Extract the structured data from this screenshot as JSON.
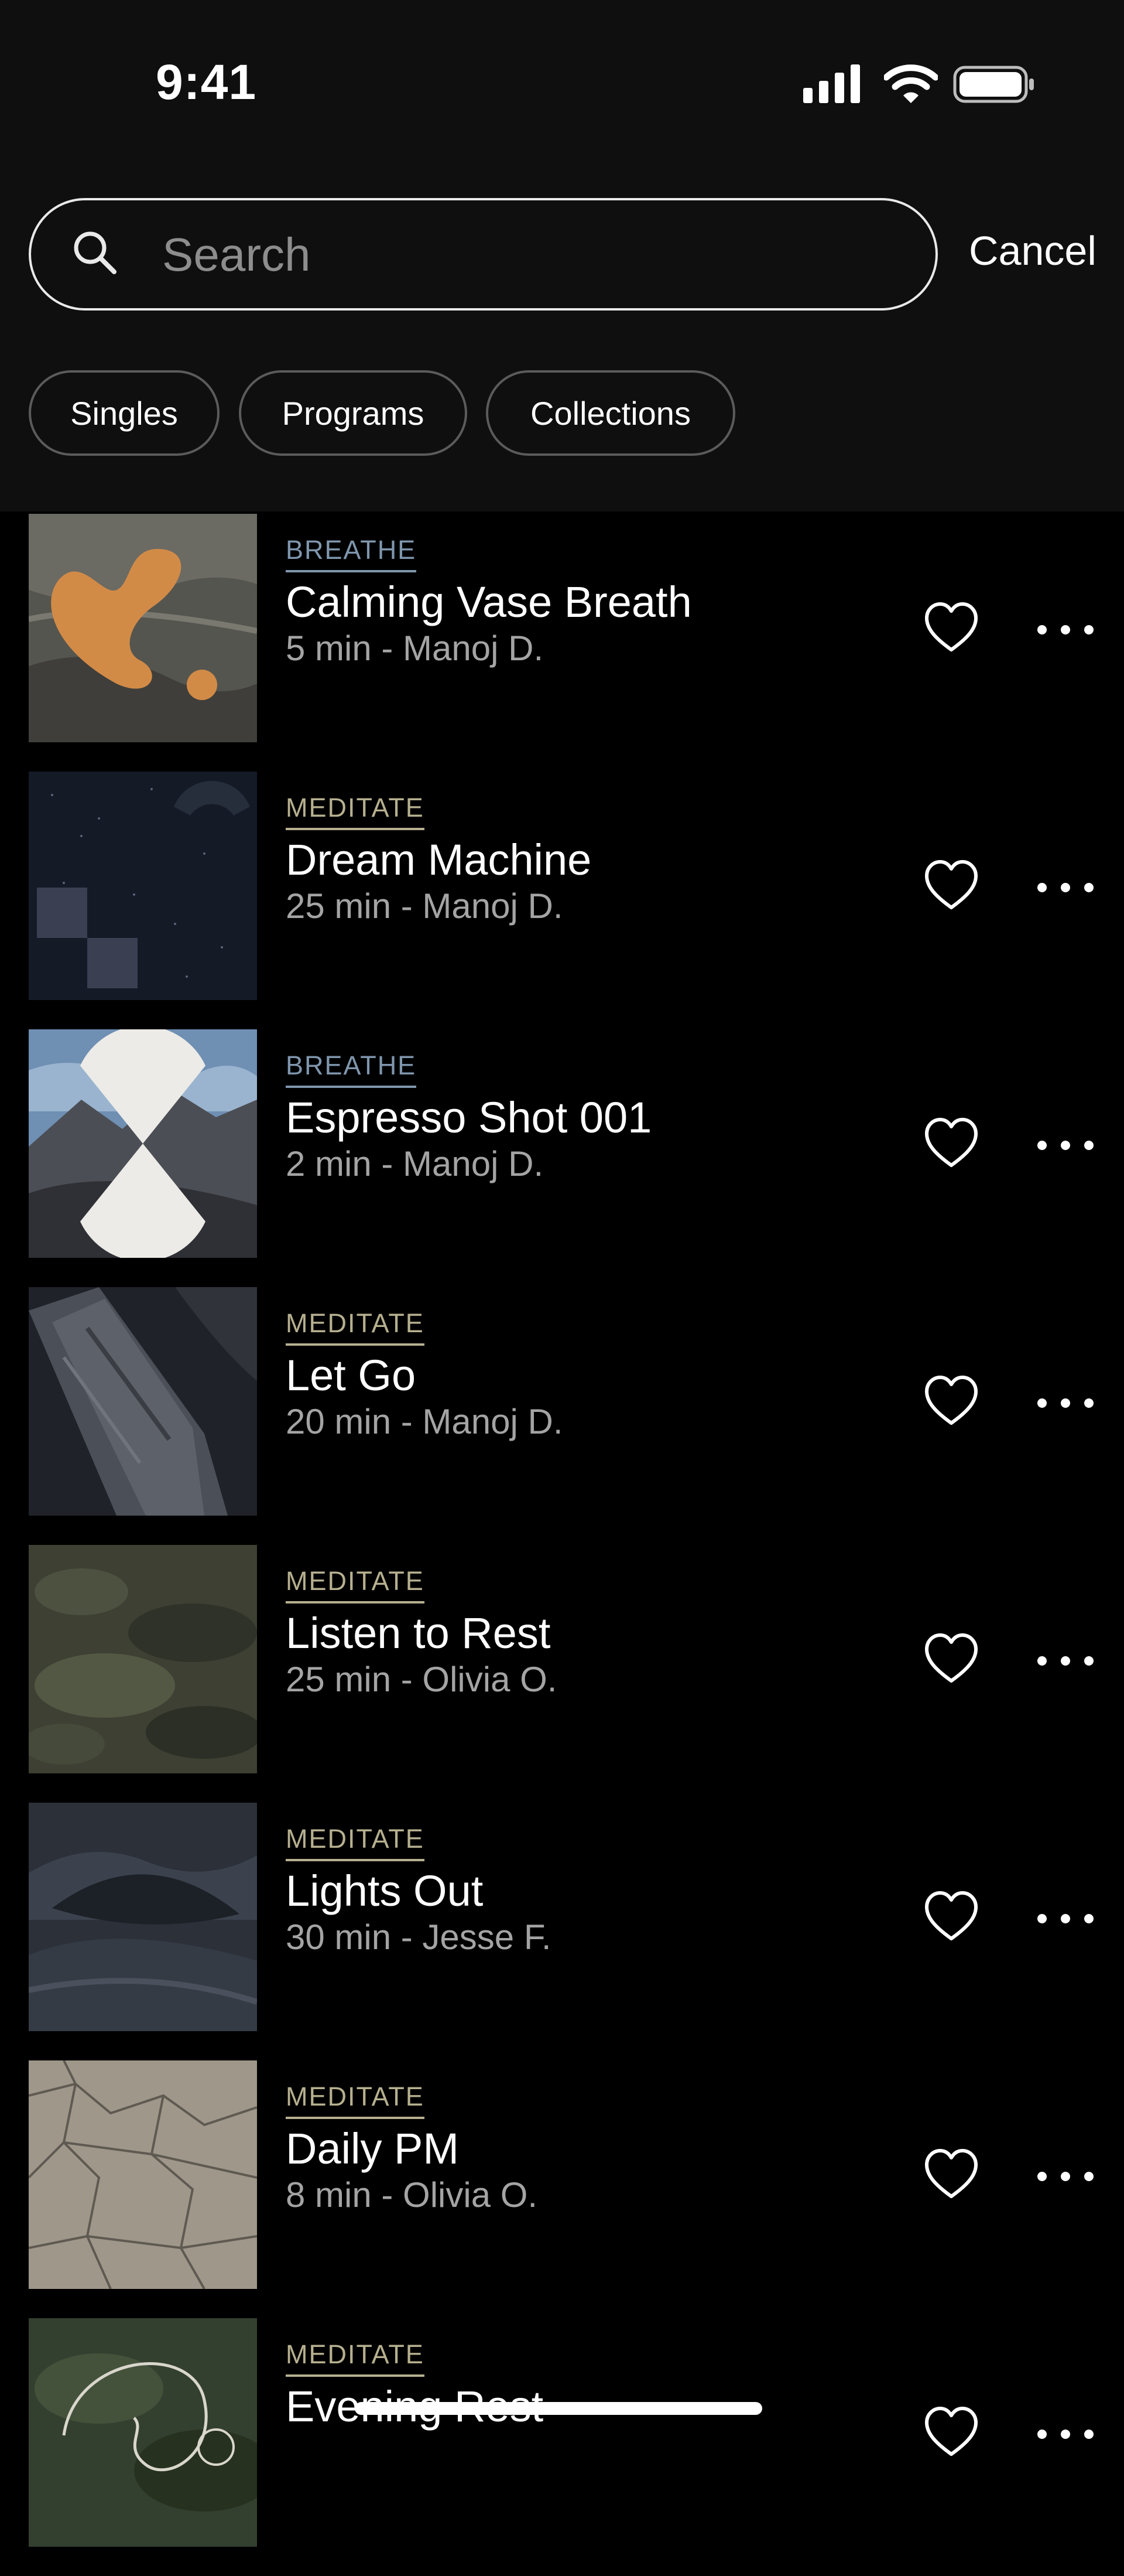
{
  "status_bar": {
    "time": "9:41"
  },
  "search": {
    "placeholder": "Search",
    "value": "",
    "cancel_label": "Cancel"
  },
  "filters": [
    {
      "label": "Singles"
    },
    {
      "label": "Programs"
    },
    {
      "label": "Collections"
    }
  ],
  "colors": {
    "background": "#000000",
    "header_background": "#0f0f0f",
    "breathe_category": "#7f96ad",
    "meditate_category": "#b6b08f",
    "subtitle": "#a4a4a4"
  },
  "items": [
    {
      "category": "BREATHE",
      "title": "Calming Vase Breath",
      "subtitle": "5 min - Manoj D.",
      "artwork": "orange-vase-on-canyon"
    },
    {
      "category": "MEDITATE",
      "title": "Dream Machine",
      "subtitle": "25 min - Manoj D.",
      "artwork": "starry-night-squares"
    },
    {
      "category": "BREATHE",
      "title": "Espresso Shot 001",
      "subtitle": "2 min - Manoj D.",
      "artwork": "hourglass-over-mountains"
    },
    {
      "category": "MEDITATE",
      "title": "Let Go",
      "subtitle": "20 min - Manoj D.",
      "artwork": "dark-rock-ridge"
    },
    {
      "category": "MEDITATE",
      "title": "Listen to Rest",
      "subtitle": "25 min - Olivia O.",
      "artwork": "mossy-terrain"
    },
    {
      "category": "MEDITATE",
      "title": "Lights Out",
      "subtitle": "30 min - Jesse F.",
      "artwork": "dark-hills"
    },
    {
      "category": "MEDITATE",
      "title": "Daily PM",
      "subtitle": "8 min - Olivia O.",
      "artwork": "cracked-earth"
    },
    {
      "category": "MEDITATE",
      "title": "Evening Rest",
      "subtitle": "",
      "artwork": "green-terrain-outline"
    }
  ]
}
